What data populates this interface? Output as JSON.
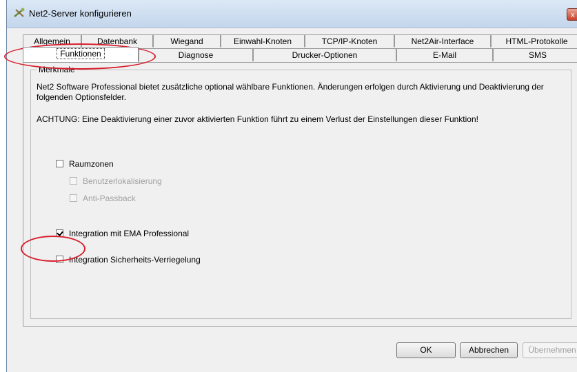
{
  "window": {
    "title": "Net2-Server konfigurieren",
    "close_label": "x"
  },
  "tabs": {
    "row1": [
      "Allgemein",
      "Datenbank",
      "Wiegand",
      "Einwahl-Knoten",
      "TCP/IP-Knoten",
      "Net2Air-Interface",
      "HTML-Protokolle"
    ],
    "row2": [
      "Funktionen",
      "Diagnose",
      "Drucker-Optionen",
      "E-Mail",
      "SMS"
    ],
    "active": "Funktionen"
  },
  "group": {
    "label": "Merkmale",
    "description": "Net2 Software Professional bietet zusätzliche optional wählbare Funktionen. Änderungen erfolgen durch Aktivierung und Deaktivierung der folgenden Optionsfelder.",
    "warning": "ACHTUNG: Eine Deaktivierung einer zuvor aktivierten Funktion führt zu einem Verlust der Einstellungen dieser Funktion!"
  },
  "options": [
    {
      "label": "Raumzonen",
      "checked": false,
      "enabled": true
    },
    {
      "label": "Benutzerlokalisierung",
      "checked": false,
      "enabled": false
    },
    {
      "label": "Anti-Passback",
      "checked": false,
      "enabled": false
    },
    {
      "label": "Integration mit EMA Professional",
      "checked": true,
      "enabled": true
    },
    {
      "label": "Integration Sicherheits-Verriegelung",
      "checked": false,
      "enabled": true
    }
  ],
  "buttons": {
    "ok": "OK",
    "cancel": "Abbrechen",
    "apply": "Übernehmen"
  },
  "colors": {
    "annotation": "#d81e2c",
    "window_bg": "#f0f0f0"
  }
}
